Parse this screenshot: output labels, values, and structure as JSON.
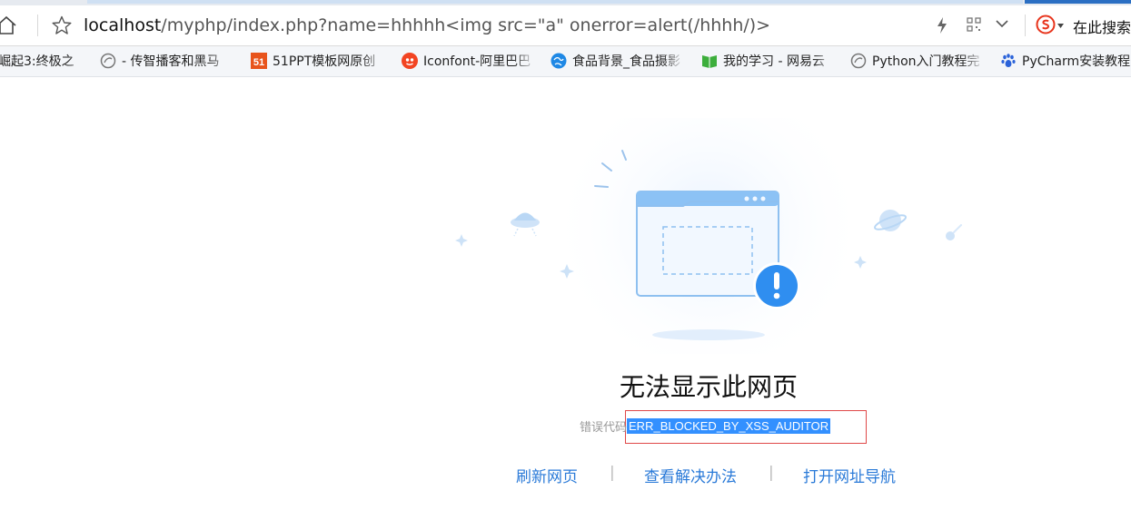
{
  "browser": {
    "url": {
      "host": "localhost",
      "rest": "/myphp/index.php?name=hhhhh<img src=\"a\" onerror=alert(/hhhh/)>"
    },
    "search_label": "在此搜索"
  },
  "bookmarks": [
    {
      "label": "崛起3:终极之",
      "icon": "partial-bookmark-icon"
    },
    {
      "label": "- 传智播客和黑马",
      "icon": "globe-icon"
    },
    {
      "label": "51PPT模板网原创",
      "icon": "51ppt-logo-icon"
    },
    {
      "label": "Iconfont-阿里巴巴",
      "icon": "iconfont-logo-icon"
    },
    {
      "label": "食品背景_食品摄影",
      "icon": "blue-globe-icon"
    },
    {
      "label": "我的学习 - 网易云",
      "icon": "green-book-icon"
    },
    {
      "label": "Python入门教程完",
      "icon": "globe-icon"
    },
    {
      "label": "PyCharm安装教程",
      "icon": "baidu-paw-icon"
    }
  ],
  "error_page": {
    "title": "无法显示此网页",
    "error_label": "错误代码",
    "error_code": "ERR_BLOCKED_BY_XSS_AUDITOR",
    "links": [
      {
        "label": "刷新网页"
      },
      {
        "label": "查看解决办法"
      },
      {
        "label": "打开网址导航"
      }
    ],
    "separator": "|"
  },
  "colors": {
    "link": "#2a7ad8",
    "selection": "#3390ff",
    "highlight_box": "#e04848",
    "illustration_blue": "#2f8ef0"
  }
}
